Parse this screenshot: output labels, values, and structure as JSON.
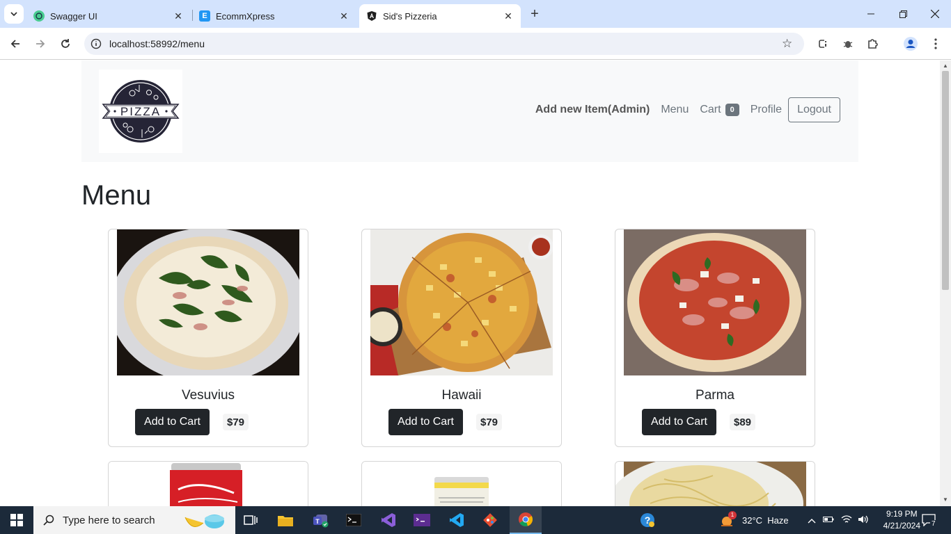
{
  "browser": {
    "tabs": [
      {
        "title": "Swagger UI",
        "icon": "swagger-icon",
        "color": "#49cc90"
      },
      {
        "title": "EcommXpress",
        "icon": "ecommxpress-icon",
        "color": "#2196f3",
        "glyph": "E"
      },
      {
        "title": "Sid's Pizzeria",
        "icon": "angular-icon",
        "color": "#1f1f1f"
      }
    ],
    "url": "localhost:58992/menu"
  },
  "site": {
    "logo_text": "PIZZA",
    "nav": {
      "add_item": "Add new Item(Admin)",
      "menu": "Menu",
      "cart": "Cart",
      "cart_count": "0",
      "profile": "Profile",
      "logout": "Logout"
    },
    "page_title": "Menu",
    "items": [
      {
        "name": "Vesuvius",
        "price": "$79",
        "button": "Add to Cart"
      },
      {
        "name": "Hawaii",
        "price": "$79",
        "button": "Add to Cart"
      },
      {
        "name": "Parma",
        "price": "$89",
        "button": "Add to Cart"
      }
    ]
  },
  "taskbar": {
    "search_placeholder": "Type here to search",
    "weather": "32°C  Haze",
    "time": "9:19 PM",
    "date": "4/21/2024",
    "notification_count": "7",
    "weather_badge": "1"
  }
}
